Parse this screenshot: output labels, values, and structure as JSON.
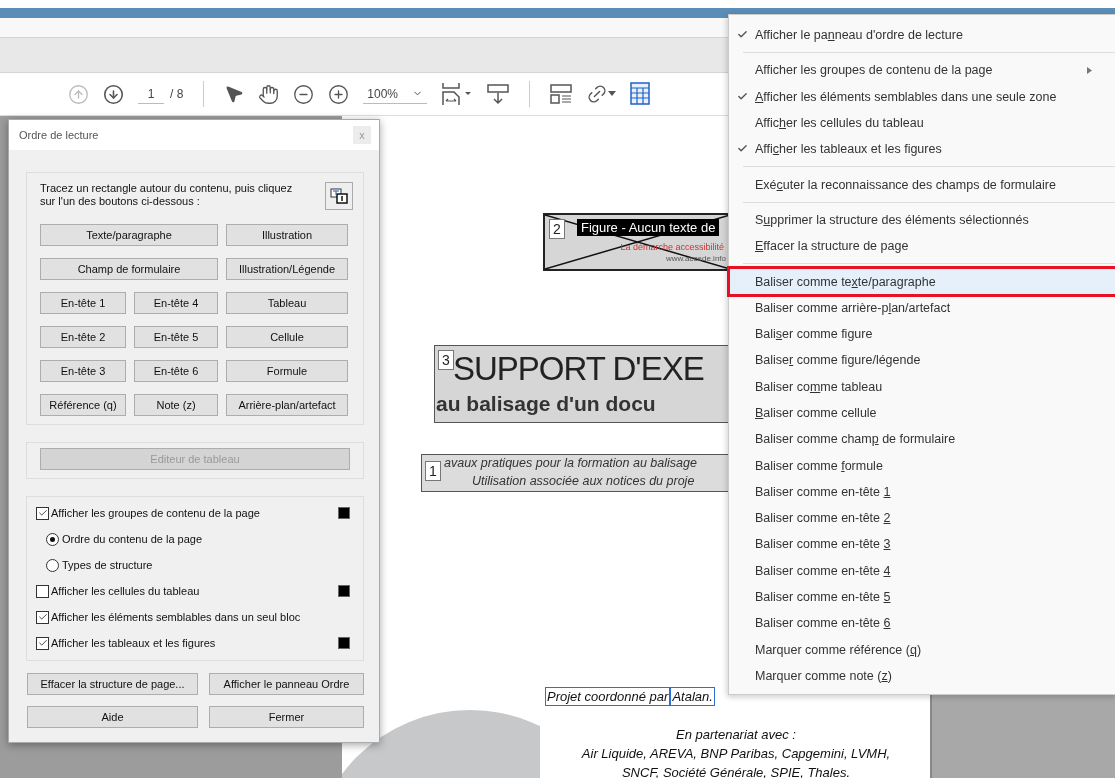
{
  "toolbar": {
    "page_number": "1",
    "page_total": "/ 8",
    "zoom": "100%"
  },
  "document": {
    "figure": {
      "badge": "2",
      "label": "Figure - Aucun texte de",
      "tagline": "La démarche accessibilité",
      "url": "www.accede.info"
    },
    "heading": {
      "badge": "3",
      "title": "SUPPORT D'EXE",
      "subtitle": "au balisage d'un docu"
    },
    "intro": {
      "badge": "1",
      "lines": [
        "avaux pratiques pour la formation au balisage",
        "Utilisation associée aux notices du proje"
      ]
    },
    "credit": [
      "Projet coordonné par",
      "Atalan."
    ],
    "partners": [
      "En partenariat avec :",
      "Air Liquide, AREVA, BNP Paribas, Capgemini, LVMH,",
      "SNCF, Société Générale, SPIE, Thales."
    ]
  },
  "dialog": {
    "title": "Ordre de lecture",
    "close": "x",
    "instructions": "Tracez un rectangle autour du contenu, puis cliquez sur l'un des boutons ci-dessous :",
    "tag_buttons": [
      [
        {
          "label": "Texte/paragraphe",
          "kind": "wide"
        },
        {
          "label": "Illustration",
          "kind": "normal"
        }
      ],
      [
        {
          "label": "Champ de formulaire",
          "kind": "wide"
        },
        {
          "label": "Illustration/Légende",
          "kind": "normal"
        }
      ],
      [
        {
          "label": "En-tête 1",
          "kind": "normal"
        },
        {
          "label": "En-tête 4",
          "kind": "normal"
        },
        {
          "label": "Tableau",
          "kind": "normal"
        }
      ],
      [
        {
          "label": "En-tête 2",
          "kind": "normal"
        },
        {
          "label": "En-tête 5",
          "kind": "normal"
        },
        {
          "label": "Cellule",
          "kind": "normal"
        }
      ],
      [
        {
          "label": "En-tête 3",
          "kind": "normal"
        },
        {
          "label": "En-tête 6",
          "kind": "normal"
        },
        {
          "label": "Formule",
          "kind": "normal"
        }
      ],
      [
        {
          "label": "Référence (q)",
          "kind": "normal"
        },
        {
          "label": "Note (z)",
          "kind": "normal"
        },
        {
          "label": "Arrière-plan/artefact",
          "kind": "normal"
        }
      ]
    ],
    "table_editor": {
      "label": "Editeur de tableau",
      "disabled": true
    },
    "options": [
      {
        "kind": "checkbox",
        "label": "Afficher les groupes de contenu de la page",
        "checked": true,
        "color": "#000000"
      },
      {
        "kind": "radio",
        "label": "Ordre du contenu de la page",
        "selected": true
      },
      {
        "kind": "radio",
        "label": "Types de structure",
        "selected": false
      },
      {
        "kind": "checkbox",
        "label": "Afficher les cellules du tableau",
        "checked": false,
        "color": "#000000"
      },
      {
        "kind": "checkbox",
        "label": "Afficher les éléments semblables dans un seul bloc",
        "checked": true
      },
      {
        "kind": "checkbox",
        "label": "Afficher les tableaux et les figures",
        "checked": true,
        "color": "#000000"
      }
    ],
    "footer_buttons": [
      [
        "Effacer la structure de page...",
        "Afficher le panneau Ordre"
      ],
      [
        "Aide",
        "Fermer"
      ]
    ]
  },
  "context_menu": {
    "sections": [
      [
        {
          "label": [
            "Afficher le pa",
            "n",
            "neau d'ordre de lecture"
          ],
          "checked": true,
          "selected": false
        }
      ],
      [
        {
          "label": [
            "Afficher les ",
            "g",
            "roupes de contenu de la page"
          ],
          "checked": false,
          "submenu": true,
          "selected": false
        },
        {
          "label": {
            "key": "A",
            "after": "fficher les éléments semblables dans une seule zone"
          },
          "checked": true,
          "selected": false
        },
        {
          "label": [
            "Affic",
            "h",
            "er les cellules du tableau"
          ],
          "checked": false,
          "selected": false
        },
        {
          "label": [
            "Affi",
            "c",
            "her les tableaux et les figures"
          ],
          "checked": true,
          "selected": false
        }
      ],
      [
        {
          "label": [
            "Exé",
            "c",
            "uter la reconnaissance des champs de formulaire"
          ],
          "selected": false
        }
      ],
      [
        {
          "label": [
            "S",
            "u",
            "pprimer la structure des éléments sélectionnés"
          ],
          "selected": false
        },
        {
          "label": {
            "key": "E",
            "after": "ffacer la structure de page"
          },
          "selected": false
        }
      ],
      [
        {
          "label": [
            "Baliser comme te",
            "x",
            "te/paragraphe"
          ],
          "selected": true
        },
        {
          "label": [
            "Baliser comme arrière-p",
            "l",
            "an/artefact"
          ],
          "selected": false
        },
        {
          "label": [
            "Bali",
            "s",
            "er comme figure"
          ],
          "selected": false
        },
        {
          "label": [
            "Balise",
            "r",
            " comme figure/légende"
          ],
          "selected": false
        },
        {
          "label": [
            "Baliser co",
            "m",
            "me tableau"
          ],
          "selected": false
        },
        {
          "label": {
            "key": "B",
            "after": "aliser comme cellule"
          },
          "selected": false
        },
        {
          "label": [
            "Baliser comme cham",
            "p",
            " de formulaire"
          ],
          "selected": false
        },
        {
          "label": [
            "Baliser comme ",
            "f",
            "ormule"
          ],
          "selected": false
        },
        {
          "label": [
            "Baliser comme en-tête ",
            "1"
          ],
          "selected": false
        },
        {
          "label": [
            "Baliser comme en-tête ",
            "2"
          ],
          "selected": false
        },
        {
          "label": [
            "Baliser comme en-tête ",
            "3"
          ],
          "selected": false
        },
        {
          "label": [
            "Baliser comme en-tête ",
            "4"
          ],
          "selected": false
        },
        {
          "label": [
            "Baliser comme en-tête ",
            "5"
          ],
          "selected": false
        },
        {
          "label": [
            "Baliser comme en-tête ",
            "6"
          ],
          "selected": false
        },
        {
          "label": [
            "Marquer comme référence (",
            "q",
            ")"
          ],
          "selected": false
        },
        {
          "label": [
            "Marquer comme note (",
            "z",
            ")"
          ],
          "selected": false
        }
      ]
    ]
  }
}
